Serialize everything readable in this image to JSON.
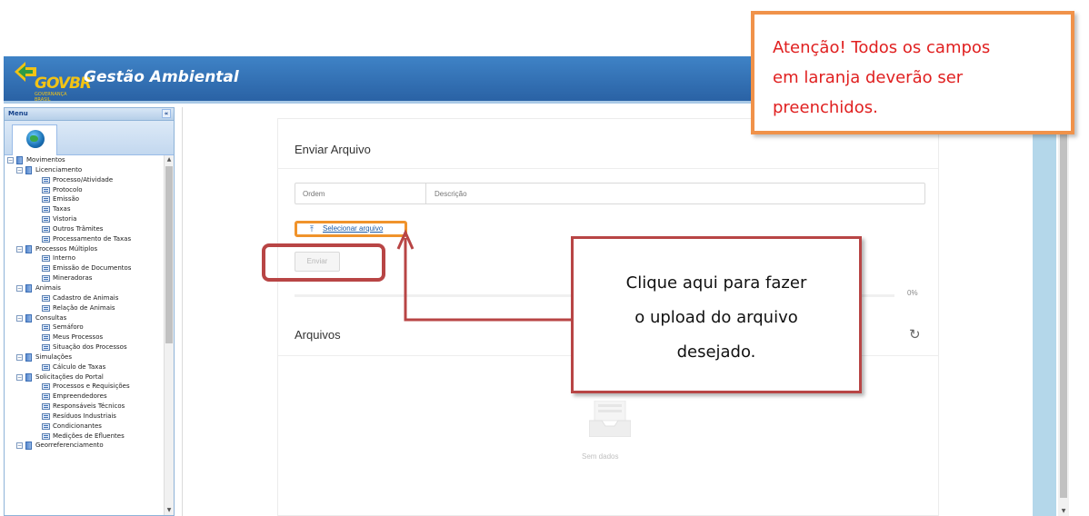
{
  "header": {
    "logo_text": "GOVBR",
    "logo_subtext": "GOVERNANÇA BRASIL",
    "app_title": "Gestão Ambiental"
  },
  "sidebar": {
    "title": "Menu",
    "collapse": "«",
    "tree": [
      {
        "label": "Movimentos",
        "level": 0,
        "type": "folder"
      },
      {
        "label": "Licenciamento",
        "level": 1,
        "type": "folder"
      },
      {
        "label": "Processo/Atividade",
        "level": 2,
        "type": "leaf"
      },
      {
        "label": "Protocolo",
        "level": 2,
        "type": "leaf"
      },
      {
        "label": "Emissão",
        "level": 2,
        "type": "leaf"
      },
      {
        "label": "Taxas",
        "level": 2,
        "type": "leaf"
      },
      {
        "label": "Vistoria",
        "level": 2,
        "type": "leaf"
      },
      {
        "label": "Outros Trâmites",
        "level": 2,
        "type": "leaf"
      },
      {
        "label": "Processamento de Taxas",
        "level": 2,
        "type": "leaf"
      },
      {
        "label": "Processos Múltiplos",
        "level": 1,
        "type": "folder"
      },
      {
        "label": "Interno",
        "level": 2,
        "type": "leaf"
      },
      {
        "label": "Emissão de Documentos",
        "level": 2,
        "type": "leaf"
      },
      {
        "label": "Mineradoras",
        "level": 2,
        "type": "leaf"
      },
      {
        "label": "Animais",
        "level": 1,
        "type": "folder"
      },
      {
        "label": "Cadastro de Animais",
        "level": 2,
        "type": "leaf"
      },
      {
        "label": "Relação de Animais",
        "level": 2,
        "type": "leaf"
      },
      {
        "label": "Consultas",
        "level": 1,
        "type": "folder"
      },
      {
        "label": "Semáforo",
        "level": 2,
        "type": "leaf"
      },
      {
        "label": "Meus Processos",
        "level": 2,
        "type": "leaf"
      },
      {
        "label": "Situação dos Processos",
        "level": 2,
        "type": "leaf"
      },
      {
        "label": "Simulações",
        "level": 1,
        "type": "folder"
      },
      {
        "label": "Cálculo de Taxas",
        "level": 2,
        "type": "leaf"
      },
      {
        "label": "Solicitações do Portal",
        "level": 1,
        "type": "folder"
      },
      {
        "label": "Processos e Requisições",
        "level": 2,
        "type": "leaf"
      },
      {
        "label": "Empreendedores",
        "level": 2,
        "type": "leaf"
      },
      {
        "label": "Responsáveis Técnicos",
        "level": 2,
        "type": "leaf"
      },
      {
        "label": "Resíduos Industriais",
        "level": 2,
        "type": "leaf"
      },
      {
        "label": "Condicionantes",
        "level": 2,
        "type": "leaf"
      },
      {
        "label": "Medições de Efluentes",
        "level": 2,
        "type": "leaf"
      },
      {
        "label": "Georreferenciamento",
        "level": 1,
        "type": "folder"
      }
    ]
  },
  "upload": {
    "title": "Enviar Arquivo",
    "ordem_placeholder": "Ordem",
    "descricao_placeholder": "Descrição",
    "select_label": "Selecionar arquivo",
    "send_label": "Enviar",
    "progress_percent": 0,
    "progress_text": "0%"
  },
  "files": {
    "title": "Arquivos",
    "empty_text": "Sem dados"
  },
  "callouts": {
    "top_lines": [
      "Atenção! Todos os campos",
      "em laranja deverão ser",
      "preenchidos."
    ],
    "mid_lines": [
      "Clique aqui para fazer",
      "o upload do arquivo",
      "desejado."
    ]
  },
  "colors": {
    "header_blue": "#2a62a5",
    "orange": "#f0924a",
    "red_outline": "#b84545",
    "warning_text": "#e02020"
  }
}
